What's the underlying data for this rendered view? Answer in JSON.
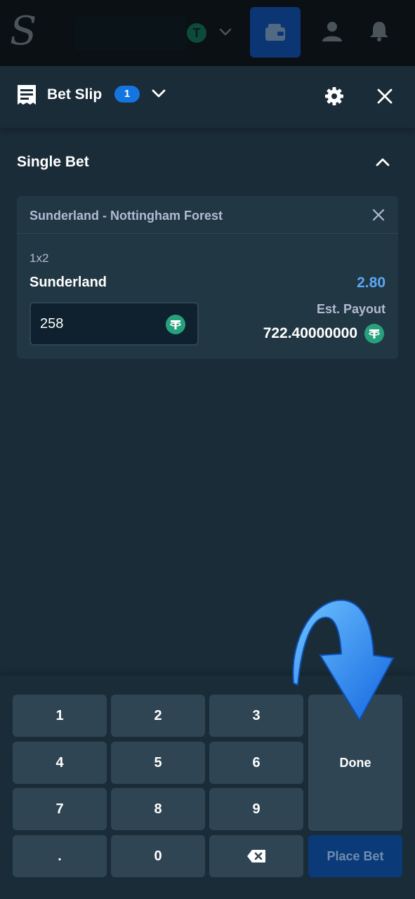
{
  "header": {
    "logo_letter": "S",
    "coin_symbol": "T"
  },
  "betslip": {
    "title": "Bet Slip",
    "count": "1"
  },
  "section": {
    "title": "Single Bet"
  },
  "bet": {
    "match": "Sunderland - Nottingham Forest",
    "market": "1x2",
    "selection": "Sunderland",
    "odds": "2.80",
    "stake": "258",
    "est_payout_label": "Est. Payout",
    "est_payout": "722.40000000",
    "coin_symbol": "T"
  },
  "keypad": {
    "keys": [
      "1",
      "2",
      "3",
      "4",
      "5",
      "6",
      "7",
      "8",
      "9",
      ".",
      "0"
    ],
    "done_label": "Done",
    "place_bet_label": "Place Bet"
  },
  "colors": {
    "accent_blue": "#1475e1",
    "odds_blue": "#5aa8f5",
    "tether_green": "#26a17b",
    "panel": "#213743",
    "background": "#1a2c38"
  }
}
